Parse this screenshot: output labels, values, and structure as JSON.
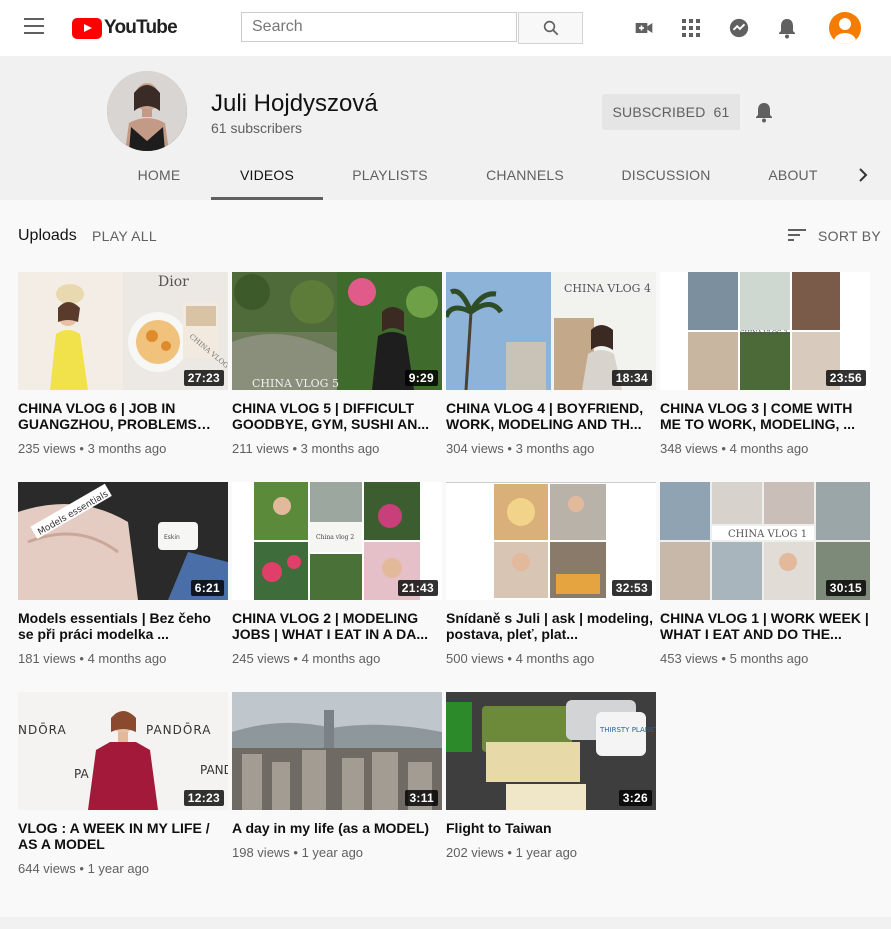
{
  "masthead": {
    "logo_text": "YouTube",
    "search_placeholder": "Search",
    "icons": [
      "menu-icon",
      "youtube-logo",
      "search-icon",
      "video-camera-icon",
      "apps-grid-icon",
      "messages-icon",
      "notifications-bell-icon",
      "user-avatar"
    ],
    "brand_color": "#ff0000",
    "user_avatar_color": "#f57c00"
  },
  "channel": {
    "name": "Juli Hojdyszová",
    "subscribers": "61 subscribers",
    "subscribed_label": "SUBSCRIBED",
    "subscribed_count": "61"
  },
  "tabs": [
    {
      "label": "HOME",
      "active": false
    },
    {
      "label": "VIDEOS",
      "active": true
    },
    {
      "label": "PLAYLISTS",
      "active": false
    },
    {
      "label": "CHANNELS",
      "active": false
    },
    {
      "label": "DISCUSSION",
      "active": false
    },
    {
      "label": "ABOUT",
      "active": false
    }
  ],
  "section": {
    "title": "Uploads",
    "play_all": "PLAY ALL",
    "sort_by": "SORT BY"
  },
  "videos": [
    {
      "title": "CHINA VLOG 6 | JOB IN GUANGZHOU, PROBLEMS WITH ...",
      "views": "235 views",
      "age": "3 months ago",
      "duration": "27:23"
    },
    {
      "title": "CHINA VLOG 5 | DIFFICULT GOODBYE, GYM, SUSHI AN...",
      "views": "211 views",
      "age": "3 months ago",
      "duration": "9:29"
    },
    {
      "title": "CHINA VLOG 4 | BOYFRIEND, WORK, MODELING AND TH...",
      "views": "304 views",
      "age": "3 months ago",
      "duration": "18:34"
    },
    {
      "title": "CHINA VLOG 3 | COME WITH ME TO WORK, MODELING, ...",
      "views": "348 views",
      "age": "4 months ago",
      "duration": "23:56"
    },
    {
      "title": "Models essentials | Bez čeho se při práci modelka ...",
      "views": "181 views",
      "age": "4 months ago",
      "duration": "6:21"
    },
    {
      "title": "CHINA VLOG 2 | MODELING JOBS | WHAT I EAT IN A DA...",
      "views": "245 views",
      "age": "4 months ago",
      "duration": "21:43"
    },
    {
      "title": "Snídaně s Juli | ask | modeling, postava, pleť, plat...",
      "views": "500 views",
      "age": "4 months ago",
      "duration": "32:53"
    },
    {
      "title": "CHINA VLOG 1 | WORK WEEK | WHAT I EAT AND DO THE...",
      "views": "453 views",
      "age": "5 months ago",
      "duration": "30:15"
    },
    {
      "title": "VLOG : A WEEK IN MY LIFE / AS A MODEL",
      "views": "644 views",
      "age": "1 year ago",
      "duration": "12:23"
    },
    {
      "title": "A day in my life (as a MODEL)",
      "views": "198 views",
      "age": "1 year ago",
      "duration": "3:11"
    },
    {
      "title": "Flight to Taiwan",
      "views": "202 views",
      "age": "1 year ago",
      "duration": "3:26"
    }
  ],
  "thumbnail_text": {
    "v1_brand": "Dior",
    "v1_overlay": "CHINA VLOG 6",
    "v2_overlay": "CHINA VLOG 5",
    "v3_overlay": "CHINA VLOG 4",
    "v4_overlay": "CHINA VLOG 3",
    "v5_overlay": "Models essentials",
    "v5_jar": "Eskin",
    "v6_overlay": "China vlog 2",
    "v8_overlay": "CHINA VLOG 1",
    "v9_brand": "PANDŌRA",
    "v9_brand_left": "NDŌRA",
    "v9_brand_right": "PAND",
    "v9_brand_mid": "PA",
    "v11_cup": "THIRSTY PLANET"
  }
}
